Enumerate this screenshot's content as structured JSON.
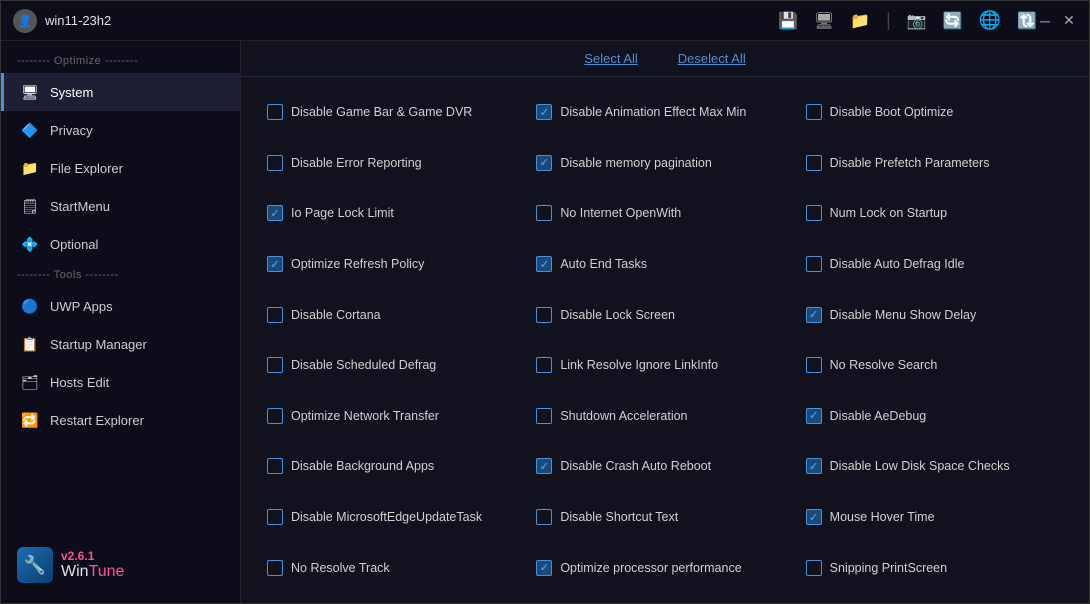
{
  "titleBar": {
    "profileLabel": "win11-23h2",
    "icons": [
      {
        "name": "save-icon",
        "symbol": "💾"
      },
      {
        "name": "restore-icon",
        "symbol": "🖥"
      },
      {
        "name": "folder-icon",
        "symbol": "📁"
      },
      {
        "name": "camera-icon",
        "symbol": "📷"
      },
      {
        "name": "history-icon",
        "symbol": "🔄"
      },
      {
        "name": "globe-icon",
        "symbol": "🌐"
      },
      {
        "name": "refresh-icon",
        "symbol": "🔃"
      }
    ],
    "controls": {
      "minimize": "─",
      "close": "✕"
    }
  },
  "sidebar": {
    "optimizeLabel": "-------- Optimize --------",
    "toolsLabel": "-------- Tools --------",
    "items": [
      {
        "id": "system",
        "label": "System",
        "icon": "🖥",
        "active": true
      },
      {
        "id": "privacy",
        "label": "Privacy",
        "icon": "🔷"
      },
      {
        "id": "file-explorer",
        "label": "File Explorer",
        "icon": "📁"
      },
      {
        "id": "startmenu",
        "label": "StartMenu",
        "icon": "🗒"
      },
      {
        "id": "optional",
        "label": "Optional",
        "icon": "💠"
      },
      {
        "id": "uwp-apps",
        "label": "UWP Apps",
        "icon": "🔵"
      },
      {
        "id": "startup-manager",
        "label": "Startup Manager",
        "icon": "📋"
      },
      {
        "id": "hosts-edit",
        "label": "Hosts Edit",
        "icon": "🗂"
      },
      {
        "id": "restart-explorer",
        "label": "Restart Explorer",
        "icon": "🔁"
      }
    ],
    "version": "v2.6.1",
    "brandName": "WinTune"
  },
  "content": {
    "selectAll": "Select All",
    "deselectAll": "Deselect All",
    "checkboxes": [
      {
        "id": "disable-game-bar",
        "label": "Disable Game Bar & Game DVR",
        "checked": false
      },
      {
        "id": "disable-animation-effect",
        "label": "Disable Animation Effect Max Min",
        "checked": true
      },
      {
        "id": "disable-boot-optimize",
        "label": "Disable Boot Optimize",
        "checked": false
      },
      {
        "id": "disable-error-reporting",
        "label": "Disable Error Reporting",
        "checked": false
      },
      {
        "id": "disable-memory-pagination",
        "label": "Disable memory pagination",
        "checked": true
      },
      {
        "id": "disable-prefetch",
        "label": "Disable Prefetch Parameters",
        "checked": false
      },
      {
        "id": "io-page-lock-limit",
        "label": "Io Page Lock Limit",
        "checked": true
      },
      {
        "id": "no-internet-openwith",
        "label": "No Internet OpenWith",
        "checked": false
      },
      {
        "id": "num-lock-startup",
        "label": "Num Lock on Startup",
        "checked": false
      },
      {
        "id": "optimize-refresh-policy",
        "label": "Optimize Refresh Policy",
        "checked": true
      },
      {
        "id": "auto-end-tasks",
        "label": "Auto End Tasks",
        "checked": true
      },
      {
        "id": "disable-auto-defrag-idle",
        "label": "Disable Auto Defrag Idle",
        "checked": false
      },
      {
        "id": "disable-cortana",
        "label": "Disable Cortana",
        "checked": false
      },
      {
        "id": "disable-lock-screen",
        "label": "Disable Lock Screen",
        "checked": false
      },
      {
        "id": "disable-menu-show-delay",
        "label": "Disable Menu Show Delay",
        "checked": true
      },
      {
        "id": "disable-scheduled-defrag",
        "label": "Disable Scheduled Defrag",
        "checked": false
      },
      {
        "id": "link-resolve-ignore",
        "label": "Link Resolve Ignore LinkInfo",
        "checked": false
      },
      {
        "id": "no-resolve-search",
        "label": "No Resolve Search",
        "checked": false
      },
      {
        "id": "optimize-network-transfer",
        "label": "Optimize Network Transfer",
        "checked": false
      },
      {
        "id": "shutdown-acceleration",
        "label": "Shutdown Acceleration",
        "checked": false
      },
      {
        "id": "disable-aedebug",
        "label": "Disable AeDebug",
        "checked": true
      },
      {
        "id": "disable-background-apps",
        "label": "Disable Background Apps",
        "checked": false
      },
      {
        "id": "disable-crash-auto-reboot",
        "label": "Disable Crash Auto Reboot",
        "checked": true
      },
      {
        "id": "disable-low-disk-space",
        "label": "Disable Low Disk Space Checks",
        "checked": true
      },
      {
        "id": "disable-ms-edge-update",
        "label": "Disable MicrosoftEdgeUpdateTask",
        "checked": false
      },
      {
        "id": "disable-shortcut-text",
        "label": "Disable Shortcut Text",
        "checked": false
      },
      {
        "id": "mouse-hover-time",
        "label": "Mouse Hover Time",
        "checked": true
      },
      {
        "id": "no-resolve-track",
        "label": "No Resolve Track",
        "checked": false
      },
      {
        "id": "optimize-processor-perf",
        "label": "Optimize processor performance",
        "checked": true
      },
      {
        "id": "snipping-printscreen",
        "label": "Snipping PrintScreen",
        "checked": false
      }
    ]
  }
}
